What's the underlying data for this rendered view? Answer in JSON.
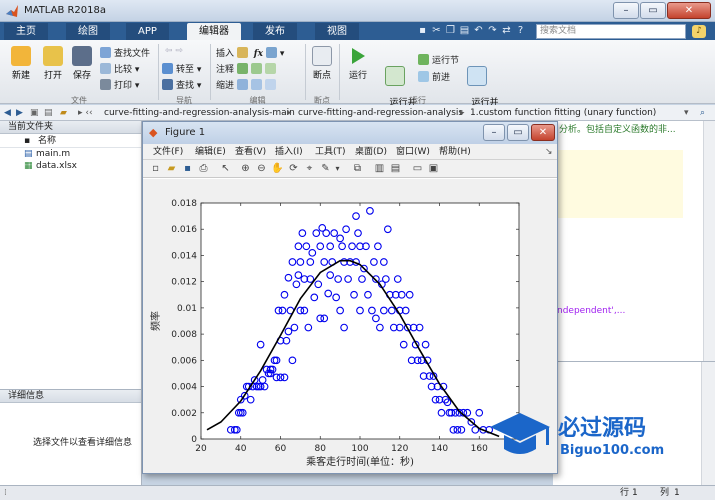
{
  "window": {
    "title": "MATLAB R2018a"
  },
  "tabs": [
    "主页",
    "绘图",
    "APP",
    "编辑器",
    "发布",
    "视图"
  ],
  "active_tab": "编辑器",
  "search": {
    "placeholder": "搜索文档"
  },
  "ribbon": {
    "file": {
      "new": "新建",
      "open": "打开",
      "save": "保存",
      "find_files": "查找文件",
      "compare": "比较",
      "print": "打印",
      "group": "文件"
    },
    "nav": {
      "goto": "转至",
      "find": "查找",
      "group": "导航"
    },
    "edit": {
      "insert": "插入",
      "comment": "注释",
      "indent": "缩进",
      "fx": "fx",
      "group": "编辑"
    },
    "breakpoints": {
      "label": "断点",
      "group": "断点"
    },
    "run": {
      "run": "运行",
      "run_advance": "运行并\n前进",
      "run_section": "运行节",
      "advance": "前进",
      "run_time": "运行并\n计时",
      "group": "运行"
    }
  },
  "address": {
    "path": [
      "curve-fitting-and-regression-analysis-main",
      "curve-fitting-and-regression-analysis",
      "1.custom function fitting (unary function)"
    ]
  },
  "current_folder": {
    "title": "当前文件夹",
    "column": "名称",
    "files": [
      "main.m",
      "data.xlsx"
    ]
  },
  "details": {
    "title": "详细信息",
    "hint": "选择文件以查看详细信息"
  },
  "editor": {
    "snippet_top": "分析。包括自定义函数的非...",
    "snippet_mid": "ndependent',..."
  },
  "status": {
    "row_label": "行",
    "row": "1",
    "col_label": "列",
    "col": "1"
  },
  "figure": {
    "title": "Figure 1",
    "menu": [
      "文件(F)",
      "编辑(E)",
      "查看(V)",
      "插入(I)",
      "工具(T)",
      "桌面(D)",
      "窗口(W)",
      "帮助(H)"
    ]
  },
  "chart_data": {
    "type": "scatter",
    "xlabel": "乘客走行时间(单位：秒)",
    "ylabel": "频率",
    "xlim": [
      20,
      180
    ],
    "ylim": [
      0,
      0.018
    ],
    "xticks": [
      20,
      40,
      60,
      80,
      100,
      120,
      140,
      160,
      180
    ],
    "yticks": [
      0,
      0.002,
      0.004,
      0.006,
      0.008,
      0.01,
      0.012,
      0.014,
      0.016,
      0.018
    ],
    "scatter_color": "#0000ee",
    "curve_color": "#000000",
    "points": [
      [
        35,
        0.0007
      ],
      [
        37,
        0.0007
      ],
      [
        38,
        0.0007
      ],
      [
        39,
        0.002
      ],
      [
        40,
        0.002
      ],
      [
        40,
        0.003
      ],
      [
        41,
        0.002
      ],
      [
        42,
        0.0033
      ],
      [
        43,
        0.004
      ],
      [
        44,
        0.004
      ],
      [
        45,
        0.003
      ],
      [
        46,
        0.004
      ],
      [
        47,
        0.0045
      ],
      [
        48,
        0.004
      ],
      [
        49,
        0.004
      ],
      [
        50,
        0.004
      ],
      [
        50,
        0.0072
      ],
      [
        51,
        0.0045
      ],
      [
        52,
        0.004
      ],
      [
        53,
        0.0053
      ],
      [
        54,
        0.005
      ],
      [
        55,
        0.005
      ],
      [
        55,
        0.0053
      ],
      [
        56,
        0.0053
      ],
      [
        57,
        0.006
      ],
      [
        58,
        0.006
      ],
      [
        58,
        0.0047
      ],
      [
        59,
        0.0098
      ],
      [
        60,
        0.0047
      ],
      [
        60,
        0.0075
      ],
      [
        61,
        0.0098
      ],
      [
        62,
        0.011
      ],
      [
        62,
        0.0047
      ],
      [
        63,
        0.0075
      ],
      [
        64,
        0.0082
      ],
      [
        64,
        0.0123
      ],
      [
        65,
        0.0098
      ],
      [
        66,
        0.0135
      ],
      [
        66,
        0.006
      ],
      [
        67,
        0.0085
      ],
      [
        68,
        0.0118
      ],
      [
        69,
        0.0147
      ],
      [
        69,
        0.0125
      ],
      [
        70,
        0.0135
      ],
      [
        70,
        0.0098
      ],
      [
        71,
        0.0157
      ],
      [
        72,
        0.0122
      ],
      [
        72,
        0.0098
      ],
      [
        73,
        0.0147
      ],
      [
        74,
        0.0085
      ],
      [
        75,
        0.0135
      ],
      [
        75,
        0.0122
      ],
      [
        76,
        0.0142
      ],
      [
        77,
        0.0108
      ],
      [
        78,
        0.0157
      ],
      [
        79,
        0.0118
      ],
      [
        80,
        0.0147
      ],
      [
        80,
        0.0092
      ],
      [
        81,
        0.0161
      ],
      [
        82,
        0.0135
      ],
      [
        82,
        0.0092
      ],
      [
        83,
        0.0157
      ],
      [
        84,
        0.0111
      ],
      [
        85,
        0.0147
      ],
      [
        85,
        0.0125
      ],
      [
        86,
        0.0135
      ],
      [
        87,
        0.0157
      ],
      [
        88,
        0.0108
      ],
      [
        89,
        0.0122
      ],
      [
        90,
        0.0153
      ],
      [
        90,
        0.0098
      ],
      [
        91,
        0.0147
      ],
      [
        92,
        0.0135
      ],
      [
        92,
        0.0085
      ],
      [
        93,
        0.016
      ],
      [
        94,
        0.0122
      ],
      [
        95,
        0.0135
      ],
      [
        96,
        0.0147
      ],
      [
        97,
        0.011
      ],
      [
        98,
        0.0135
      ],
      [
        98,
        0.017
      ],
      [
        99,
        0.0157
      ],
      [
        100,
        0.0147
      ],
      [
        100,
        0.0098
      ],
      [
        101,
        0.0122
      ],
      [
        102,
        0.013
      ],
      [
        103,
        0.0147
      ],
      [
        104,
        0.011
      ],
      [
        105,
        0.0174
      ],
      [
        106,
        0.0098
      ],
      [
        107,
        0.0135
      ],
      [
        108,
        0.0122
      ],
      [
        108,
        0.0092
      ],
      [
        109,
        0.0147
      ],
      [
        110,
        0.0085
      ],
      [
        111,
        0.0118
      ],
      [
        112,
        0.0135
      ],
      [
        112,
        0.0098
      ],
      [
        113,
        0.0122
      ],
      [
        114,
        0.016
      ],
      [
        115,
        0.011
      ],
      [
        116,
        0.0098
      ],
      [
        117,
        0.0085
      ],
      [
        118,
        0.011
      ],
      [
        119,
        0.0122
      ],
      [
        120,
        0.0098
      ],
      [
        120,
        0.0085
      ],
      [
        121,
        0.011
      ],
      [
        122,
        0.0072
      ],
      [
        123,
        0.0098
      ],
      [
        124,
        0.0085
      ],
      [
        125,
        0.011
      ],
      [
        126,
        0.006
      ],
      [
        127,
        0.0085
      ],
      [
        128,
        0.0072
      ],
      [
        129,
        0.006
      ],
      [
        130,
        0.0085
      ],
      [
        131,
        0.006
      ],
      [
        132,
        0.0048
      ],
      [
        133,
        0.0072
      ],
      [
        134,
        0.006
      ],
      [
        135,
        0.0048
      ],
      [
        136,
        0.004
      ],
      [
        137,
        0.0048
      ],
      [
        138,
        0.003
      ],
      [
        139,
        0.004
      ],
      [
        140,
        0.003
      ],
      [
        141,
        0.002
      ],
      [
        142,
        0.004
      ],
      [
        143,
        0.003
      ],
      [
        144,
        0.0028
      ],
      [
        145,
        0.002
      ],
      [
        146,
        0.002
      ],
      [
        147,
        0.0007
      ],
      [
        148,
        0.002
      ],
      [
        149,
        0.0007
      ],
      [
        150,
        0.002
      ],
      [
        151,
        0.0007
      ],
      [
        152,
        0.002
      ],
      [
        154,
        0.002
      ],
      [
        156,
        0.0013
      ],
      [
        158,
        0.0007
      ],
      [
        160,
        0.002
      ],
      [
        162,
        0.0007
      ],
      [
        165,
        0.0007
      ]
    ],
    "curve": [
      [
        23,
        0.0007
      ],
      [
        30,
        0.0013
      ],
      [
        40,
        0.0029
      ],
      [
        50,
        0.0052
      ],
      [
        60,
        0.0079
      ],
      [
        70,
        0.0107
      ],
      [
        80,
        0.0127
      ],
      [
        90,
        0.0136
      ],
      [
        95,
        0.0136
      ],
      [
        100,
        0.0133
      ],
      [
        110,
        0.0118
      ],
      [
        120,
        0.0095
      ],
      [
        130,
        0.0068
      ],
      [
        140,
        0.0042
      ],
      [
        150,
        0.0021
      ],
      [
        160,
        0.0008
      ],
      [
        170,
        0.0002
      ]
    ]
  }
}
